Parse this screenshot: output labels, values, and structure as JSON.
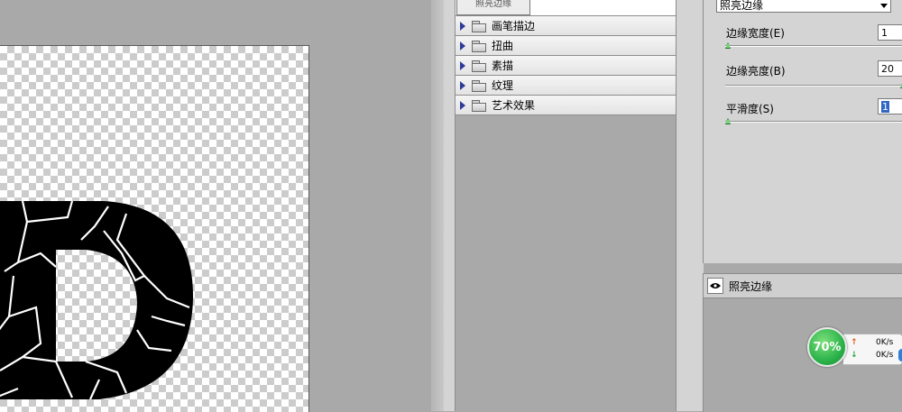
{
  "canvas": {
    "letter": "D"
  },
  "tree": {
    "top_thumb_label": "照亮边缘",
    "items": [
      {
        "label": "画笔描边"
      },
      {
        "label": "扭曲"
      },
      {
        "label": "素描"
      },
      {
        "label": "纹理"
      },
      {
        "label": "艺术效果"
      }
    ]
  },
  "settings": {
    "filter_name": "照亮边缘",
    "params": [
      {
        "label": "边缘宽度(E)",
        "value": "1",
        "level": 0.0
      },
      {
        "label": "边缘亮度(B)",
        "value": "20",
        "level": 1.0
      },
      {
        "label": "平滑度(S)",
        "value": "1",
        "level": 0.0
      }
    ]
  },
  "layers": {
    "items": [
      {
        "label": "照亮边缘",
        "icon": "eye-icon"
      }
    ]
  },
  "widget": {
    "percent": "70%",
    "upload": "0K/s",
    "download": "0K/s"
  },
  "colors": {
    "accent_green": "#2bb34a",
    "tree_triangle": "#2f3b98",
    "selection": "#3166c6"
  }
}
